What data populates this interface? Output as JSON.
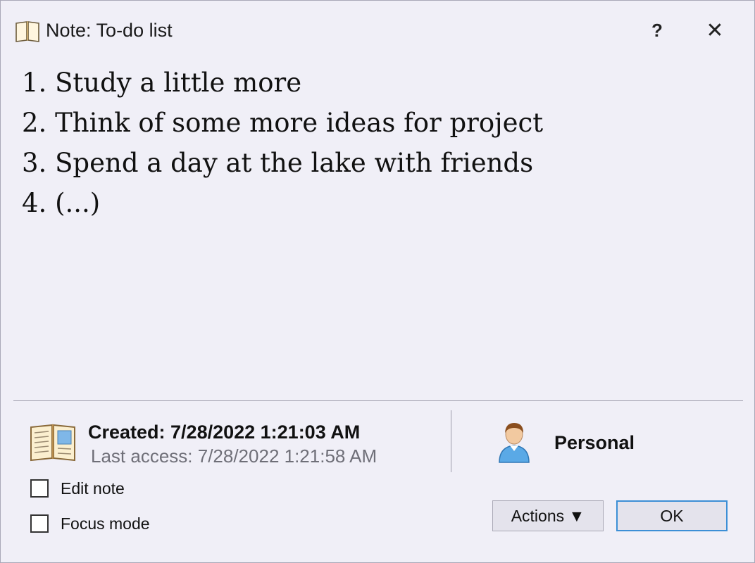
{
  "window": {
    "title": "Note: To-do list",
    "help_label": "?",
    "close_label": "✕"
  },
  "note": {
    "lines": [
      "1. Study a little more",
      "2. Think of some more ideas for project",
      "3. Spend a day at the lake with friends",
      "4. (...)"
    ]
  },
  "info": {
    "created": "Created: 7/28/2022 1:21:03 AM",
    "last_access": "Last access: 7/28/2022 1:21:58 AM",
    "category": "Personal",
    "note_icon": "book-icon",
    "category_icon": "user-icon"
  },
  "options": {
    "edit_note_label": "Edit note",
    "edit_note_checked": false,
    "focus_mode_label": "Focus mode",
    "focus_mode_checked": false
  },
  "buttons": {
    "actions_label": "Actions ▼",
    "ok_label": "OK"
  },
  "colors": {
    "background": "#f0eff7",
    "focus_border": "#3c8fd6"
  }
}
